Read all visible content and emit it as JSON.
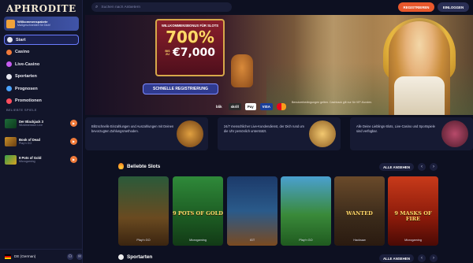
{
  "brand": {
    "logo": "APHRODITE"
  },
  "sidebar": {
    "welcome": {
      "line1": "Willkommenspakete",
      "line2": "Maßgeschneidert für Dich!"
    },
    "nav": [
      {
        "label": "Start",
        "icon": "home-icon",
        "active": true
      },
      {
        "label": "Casino",
        "icon": "casino-icon"
      },
      {
        "label": "Live-Casino",
        "icon": "live-casino-icon"
      },
      {
        "label": "Sportarten",
        "icon": "sports-icon"
      },
      {
        "label": "Prognosen",
        "icon": "predictions-icon"
      },
      {
        "label": "Promotionen",
        "icon": "gift-icon"
      }
    ],
    "recent_label": "BELIEBTE SPIELE",
    "recent": [
      {
        "name": "Der Blackjack 3",
        "provider": "Wizdimension Live"
      },
      {
        "name": "Book of Dead",
        "provider": "Play'n GO"
      },
      {
        "name": "9 Pots of Gold",
        "provider": "Microgaming"
      }
    ],
    "footer": {
      "language": "DE (German)"
    }
  },
  "topbar": {
    "search_placeholder": "Suchen nach Anbietern",
    "register": "REGISTRIEREN",
    "login": "EINLOGGEN"
  },
  "hero": {
    "promo_line": "WILLKOMMENSBONUS FÜR SLOTS",
    "percent": "700%",
    "upto": "BIS ZU",
    "amount": "€7,000",
    "cta": "SCHNELLE REGISTRIERUNG",
    "payments": [
      "blik",
      "skrill",
      "Pay",
      "VISA",
      ""
    ],
    "note": "Benutzerbedingungen gelten. Cashback gilt nur für VIP-Kunden."
  },
  "features": [
    {
      "text": "Blitzschnelle Einzahlungen und Auszahlungen mit Deinen bevorzugten Zahlungsmethoden."
    },
    {
      "text": "24/7 menschlicher Live-Kundendienst, der Dich rund um die Uhr persönlich unterstützt."
    },
    {
      "text": "Alle Deine Lieblings-Slots, Live-Casino und Sportspiele sind verfügbar."
    }
  ],
  "slots_section": {
    "title": "Beliebte Slots",
    "see_all": "ALLE ANSEHEN",
    "items": [
      {
        "title": "",
        "provider": "Play'n GO"
      },
      {
        "title": "9 POTS OF GOLD",
        "provider": "Microgaming"
      },
      {
        "title": "",
        "provider": "IGT"
      },
      {
        "title": "",
        "provider": "Play'n GO"
      },
      {
        "title": "WANTED",
        "provider": "Hacksaw"
      },
      {
        "title": "9 MASKS OF FIRE",
        "provider": "Microgaming"
      }
    ]
  },
  "sports_section": {
    "title": "Sportarten",
    "see_all": "ALLE ANSEHEN"
  }
}
